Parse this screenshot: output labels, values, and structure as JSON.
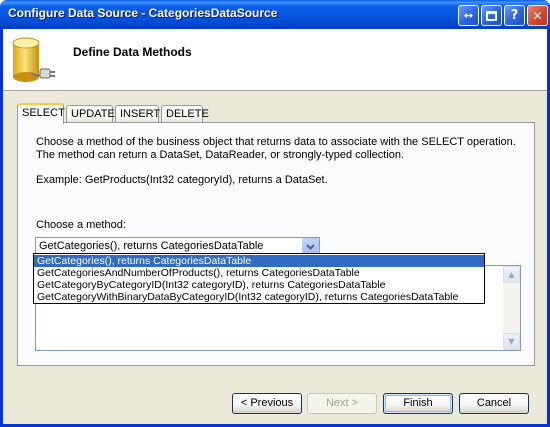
{
  "window": {
    "title": "Configure Data Source - CategoriesDataSource",
    "controls": {
      "restore_glyph": "↔",
      "help_glyph": "?",
      "close_glyph": "✕"
    }
  },
  "header": {
    "title": "Define Data Methods",
    "icon": "database-plug-icon"
  },
  "tabs": [
    {
      "label": "SELECT",
      "active": true
    },
    {
      "label": "UPDATE",
      "active": false
    },
    {
      "label": "INSERT",
      "active": false
    },
    {
      "label": "DELETE",
      "active": false
    }
  ],
  "select_panel": {
    "description": "Choose a method of the business object that returns data to associate with the SELECT operation. The method can return a DataSet, DataReader, or strongly-typed collection.",
    "example": "Example: GetProducts(Int32 categoryId), returns a DataSet.",
    "choose_label": "Choose a method:",
    "selected_method": "GetCategories(), returns CategoriesDataTable",
    "method_options": [
      "GetCategories(), returns CategoriesDataTable",
      "GetCategoriesAndNumberOfProducts(), returns CategoriesDataTable",
      "GetCategoryByCategoryID(Int32 categoryID), returns CategoriesDataTable",
      "GetCategoryWithBinaryDataByCategoryID(Int32 categoryID), returns CategoriesDataTable"
    ],
    "highlighted_option_index": 0
  },
  "buttons": {
    "previous": "< Previous",
    "next": "Next >",
    "finish": "Finish",
    "cancel": "Cancel"
  },
  "colors": {
    "titlebar": "#0553dc",
    "selection": "#316ac5",
    "tab_highlight": "#ffc83c",
    "dialog_bg": "#ece9d8"
  }
}
